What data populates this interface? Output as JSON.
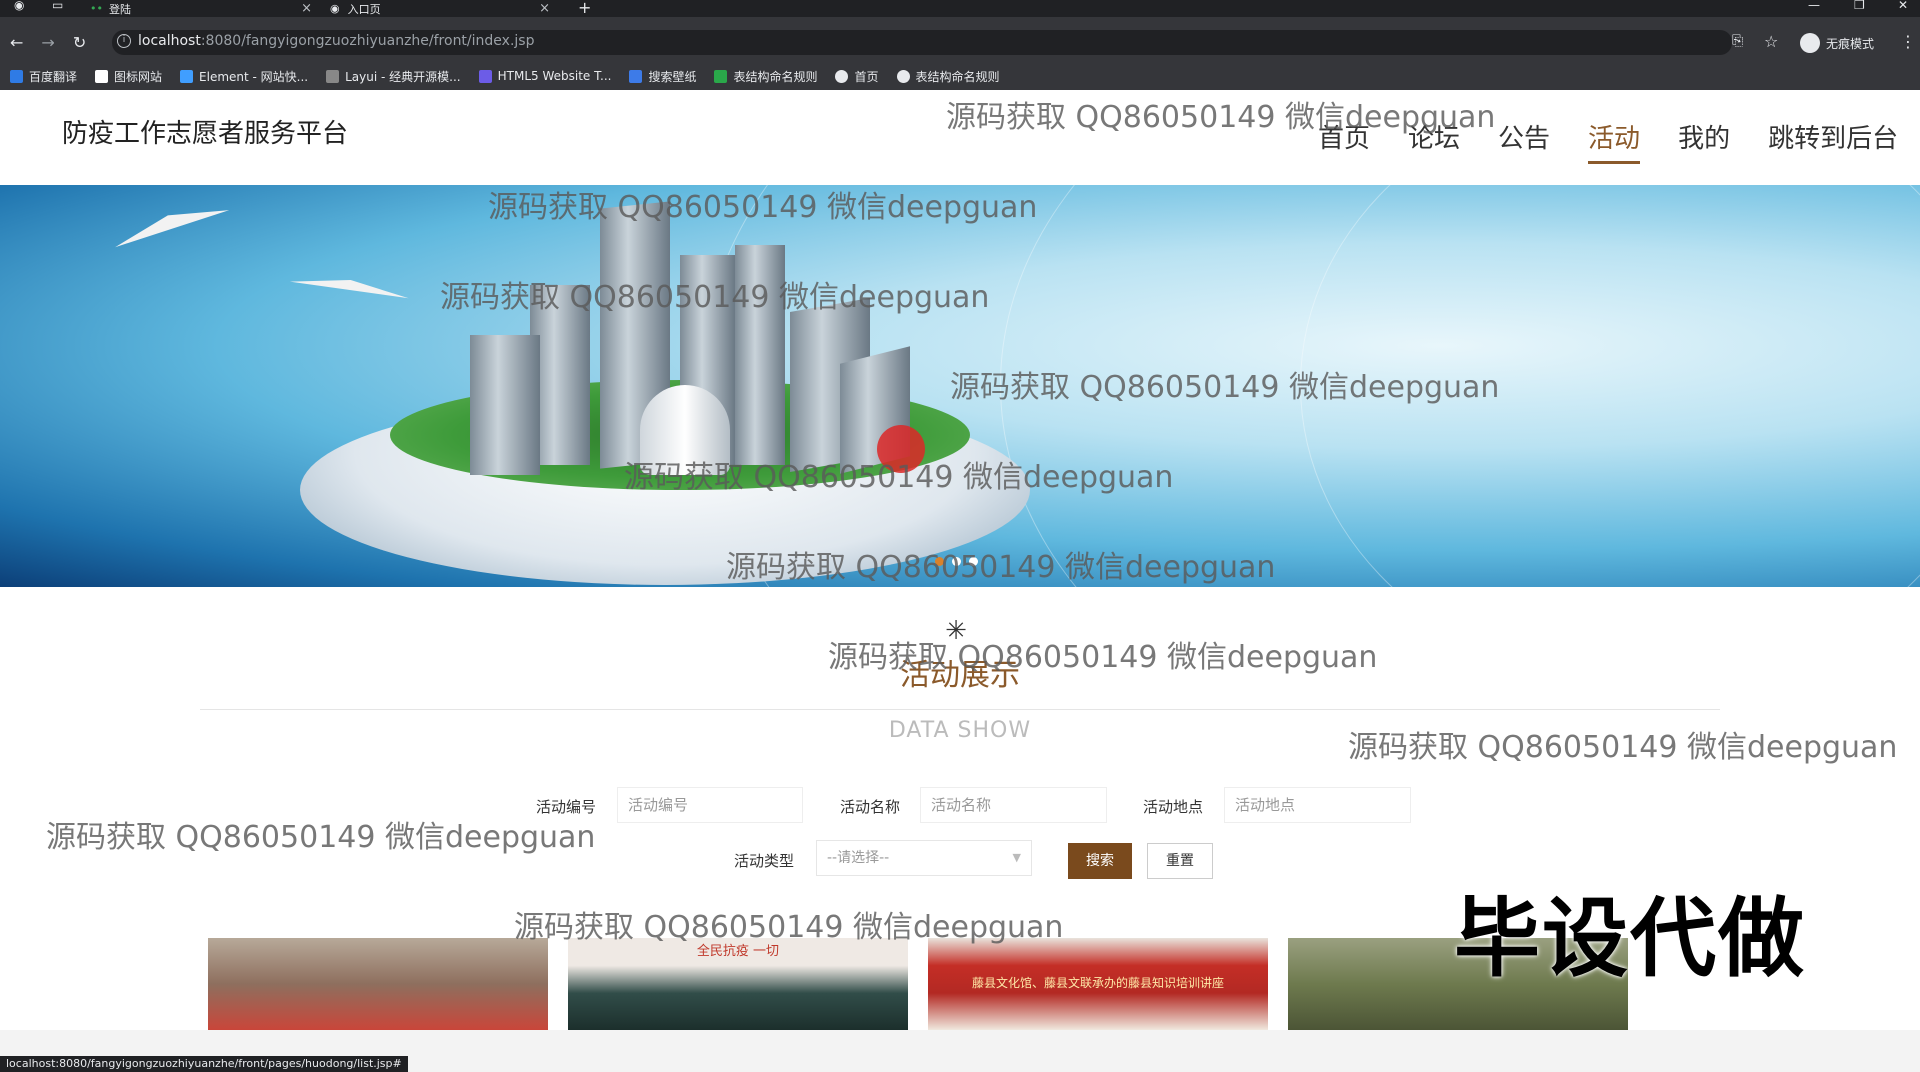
{
  "browser": {
    "tabs": [
      {
        "title": "登陆"
      },
      {
        "title": "入口页"
      }
    ],
    "url_host": "localhost",
    "url_path": ":8080/fangyigongzuozhiyuanzhe/front/index.jsp",
    "profile_label": "无痕模式",
    "bookmarks": [
      {
        "label": "百度翻译",
        "color": "#2f7be5"
      },
      {
        "label": "图标网站",
        "color": "#ffffff"
      },
      {
        "label": "Element - 网站快...",
        "color": "#409eff"
      },
      {
        "label": "Layui - 经典开源模...",
        "color": "#888888"
      },
      {
        "label": "HTML5 Website T...",
        "color": "#6c5ce7"
      },
      {
        "label": "搜索壁纸",
        "color": "#3d7be8"
      },
      {
        "label": "表结构命名规则",
        "color": "#2aa84a"
      },
      {
        "label": "首页",
        "color": "#e8eaed"
      },
      {
        "label": "表结构命名规则",
        "color": "#e8eaed"
      }
    ],
    "status_url": "localhost:8080/fangyigongzuozhiyuanzhe/front/pages/huodong/list.jsp#"
  },
  "header": {
    "site_title": "防疫工作志愿者服务平台",
    "nav": [
      {
        "label": "首页",
        "active": false
      },
      {
        "label": "论坛",
        "active": false
      },
      {
        "label": "公告",
        "active": false
      },
      {
        "label": "活动",
        "active": true
      },
      {
        "label": "我的",
        "active": false
      },
      {
        "label": "跳转到后台",
        "active": false
      }
    ],
    "accent_color": "#8b5a2b"
  },
  "banner": {
    "slides_total": 3,
    "active_slide": 1
  },
  "section": {
    "title": "活动展示",
    "subtitle": "DATA SHOW"
  },
  "search": {
    "fields": [
      {
        "label": "活动编号",
        "placeholder": "活动编号"
      },
      {
        "label": "活动名称",
        "placeholder": "活动名称"
      },
      {
        "label": "活动地点",
        "placeholder": "活动地点"
      }
    ],
    "type_label": "活动类型",
    "type_selected": "--请选择--",
    "search_button": "搜索",
    "reset_button": "重置"
  },
  "cards": [
    {
      "caption": ""
    },
    {
      "caption": "全民抗疫 一切"
    },
    {
      "caption": "藤县文化馆、藤县文联承办的藤县知识培训讲座"
    },
    {
      "caption": ""
    }
  ],
  "watermarks": {
    "text": "源码获取 QQ86050149 微信deepguan",
    "stamp": "毕设代做"
  }
}
